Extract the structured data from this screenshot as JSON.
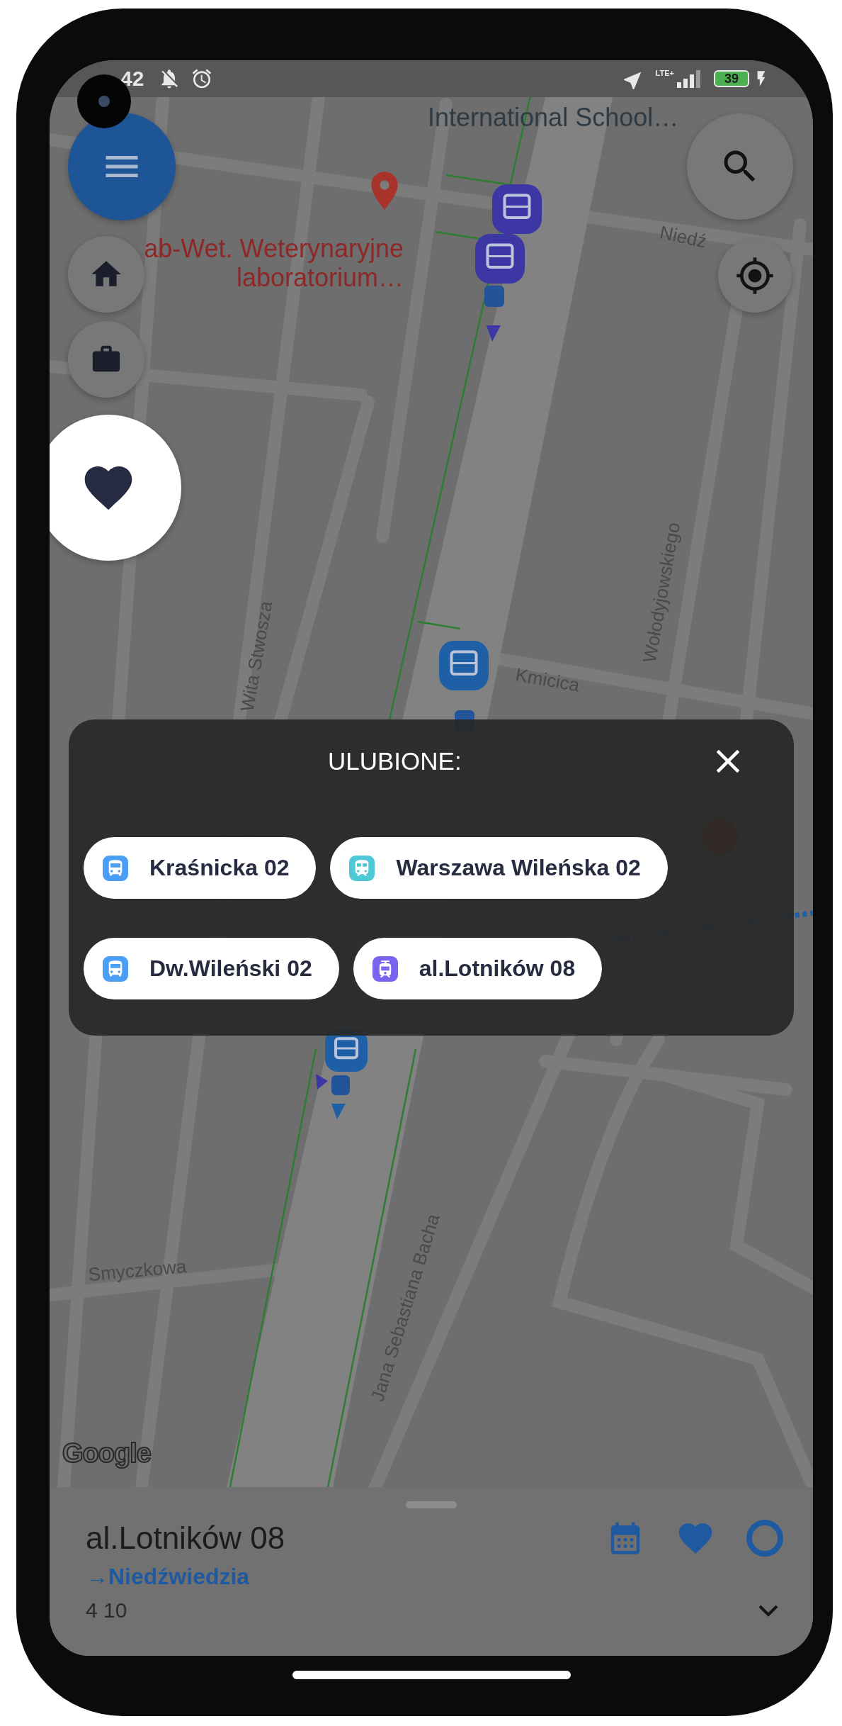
{
  "status_bar": {
    "time": "42",
    "network": "LTE+",
    "battery": "39",
    "charging": true
  },
  "map": {
    "labels": [
      {
        "text": "International School…",
        "kind": "poi"
      },
      {
        "text": "ab-Wet. Weterynaryjne laboratorium…",
        "kind": "place"
      },
      {
        "text": "Niedź",
        "kind": "street"
      },
      {
        "text": "Wita Stwosza",
        "kind": "street"
      },
      {
        "text": "Kmicica",
        "kind": "street"
      },
      {
        "text": "Wołodyjowskiego",
        "kind": "street"
      },
      {
        "text": "Smyczkowa",
        "kind": "street"
      },
      {
        "text": "Jana Sebastiana Bacha",
        "kind": "street"
      }
    ],
    "attribution": "Google"
  },
  "favorites_popup": {
    "title": "ULUBIONE:",
    "items": [
      {
        "label": "Kraśnicka 02",
        "kind": "bus",
        "color": "#4a9ff5"
      },
      {
        "label": "Warszawa Wileńska 02",
        "kind": "train",
        "color": "#4fc8d8"
      },
      {
        "label": "Dw.Wileński 02",
        "kind": "bus",
        "color": "#4a9ff5"
      },
      {
        "label": "al.Lotników 08",
        "kind": "tram",
        "color": "#7a63f0"
      }
    ]
  },
  "stop_sheet": {
    "name": "al.Lotników 08",
    "direction": "→Niedźwiedzia",
    "lines": "4 10",
    "favorite": true
  }
}
